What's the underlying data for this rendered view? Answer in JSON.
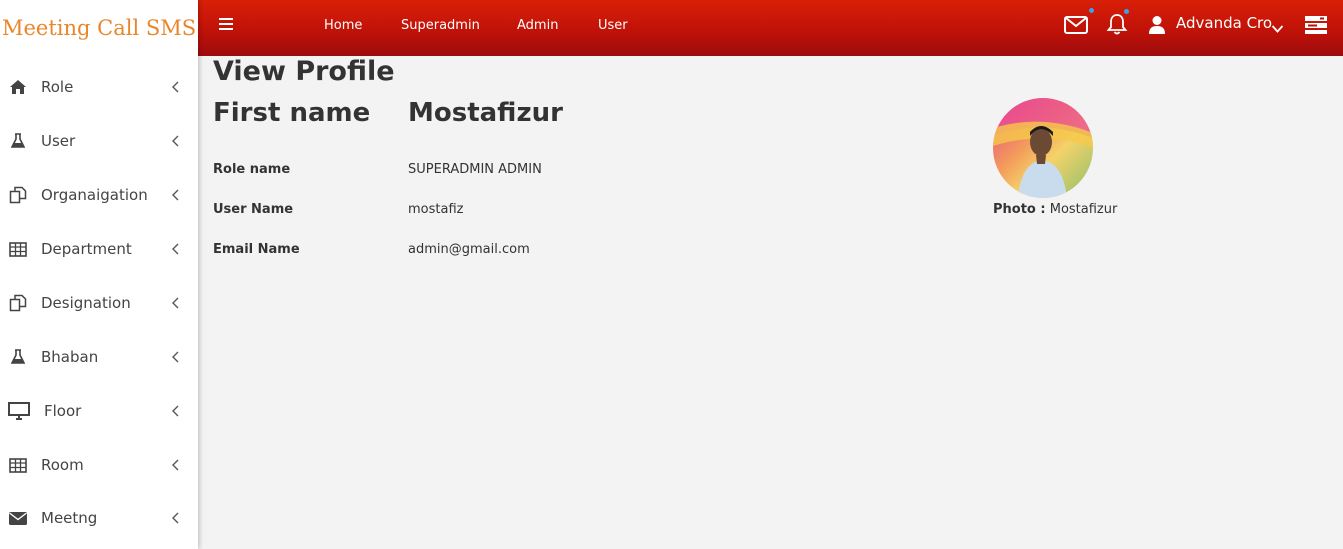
{
  "brand": {
    "title": "Meeting Call SMS",
    "color": "#e9862a"
  },
  "sidebar": {
    "items": [
      {
        "label": "Role",
        "icon": "home-icon"
      },
      {
        "label": "User",
        "icon": "flask-icon"
      },
      {
        "label": "Organaigation",
        "icon": "copy-icon"
      },
      {
        "label": "Department",
        "icon": "table-icon"
      },
      {
        "label": "Designation",
        "icon": "copy-icon"
      },
      {
        "label": "Bhaban",
        "icon": "flask-icon"
      },
      {
        "label": "Floor",
        "icon": "monitor-icon"
      },
      {
        "label": "Room",
        "icon": "table-icon"
      },
      {
        "label": "Meetng",
        "icon": "envelope-icon"
      }
    ]
  },
  "topbar": {
    "nav": [
      "Home",
      "Superadmin",
      "Admin",
      "User"
    ],
    "user_name": "Advanda Cro",
    "gradient": [
      "#d91f07",
      "#9e0b0d"
    ],
    "icons": [
      "menu-icon",
      "mail-icon",
      "bell-icon",
      "user-icon",
      "chevron-down-icon",
      "server-icon"
    ]
  },
  "profile": {
    "page_title": "View Profile",
    "first_name_label": "First name",
    "first_name": "Mostafizur",
    "role_label": "Role name",
    "role": "SUPERADMIN ADMIN",
    "username_label": "User Name",
    "username": "mostafiz",
    "email_label": "Email Name",
    "email": "admin@gmail.com",
    "photo_label": "Photo :",
    "photo_name": "Mostafizur"
  }
}
